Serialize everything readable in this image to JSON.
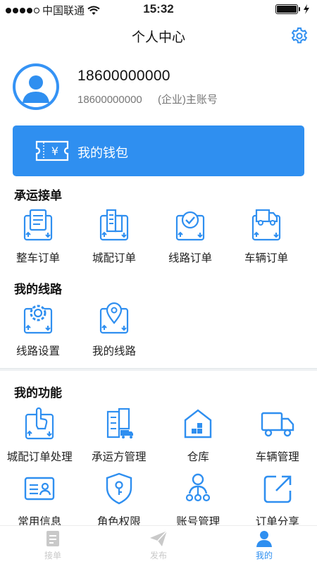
{
  "status_bar": {
    "carrier": "中国联通",
    "time": "15:32",
    "signal_bars": 5,
    "signal_filled": 4
  },
  "header": {
    "title": "个人中心",
    "settings_icon": "gear-icon"
  },
  "profile": {
    "phone": "18600000000",
    "account_phone": "18600000000",
    "account_type": "(企业)主账号"
  },
  "wallet": {
    "label": "我的钱包",
    "icon": "wallet-ticket-icon"
  },
  "sections": {
    "transport": {
      "title": "承运接单",
      "items": [
        "整车订单",
        "城配订单",
        "线路订单",
        "车辆订单"
      ]
    },
    "routes": {
      "title": "我的线路",
      "items": [
        "线路设置",
        "我的线路"
      ]
    },
    "functions": {
      "title": "我的功能",
      "items": [
        "城配订单处理",
        "承运方管理",
        "仓库",
        "车辆管理",
        "常用信息",
        "角色权限",
        "账号管理",
        "订单分享"
      ]
    }
  },
  "tabbar": {
    "items": [
      {
        "label": "接单",
        "icon": "order-list-icon",
        "active": false
      },
      {
        "label": "发布",
        "icon": "paper-plane-icon",
        "active": false
      },
      {
        "label": "我的",
        "icon": "person-icon",
        "active": true
      }
    ]
  },
  "colors": {
    "primary": "#2f8ff0",
    "inactive": "#c9c9c9",
    "text": "#222222"
  }
}
